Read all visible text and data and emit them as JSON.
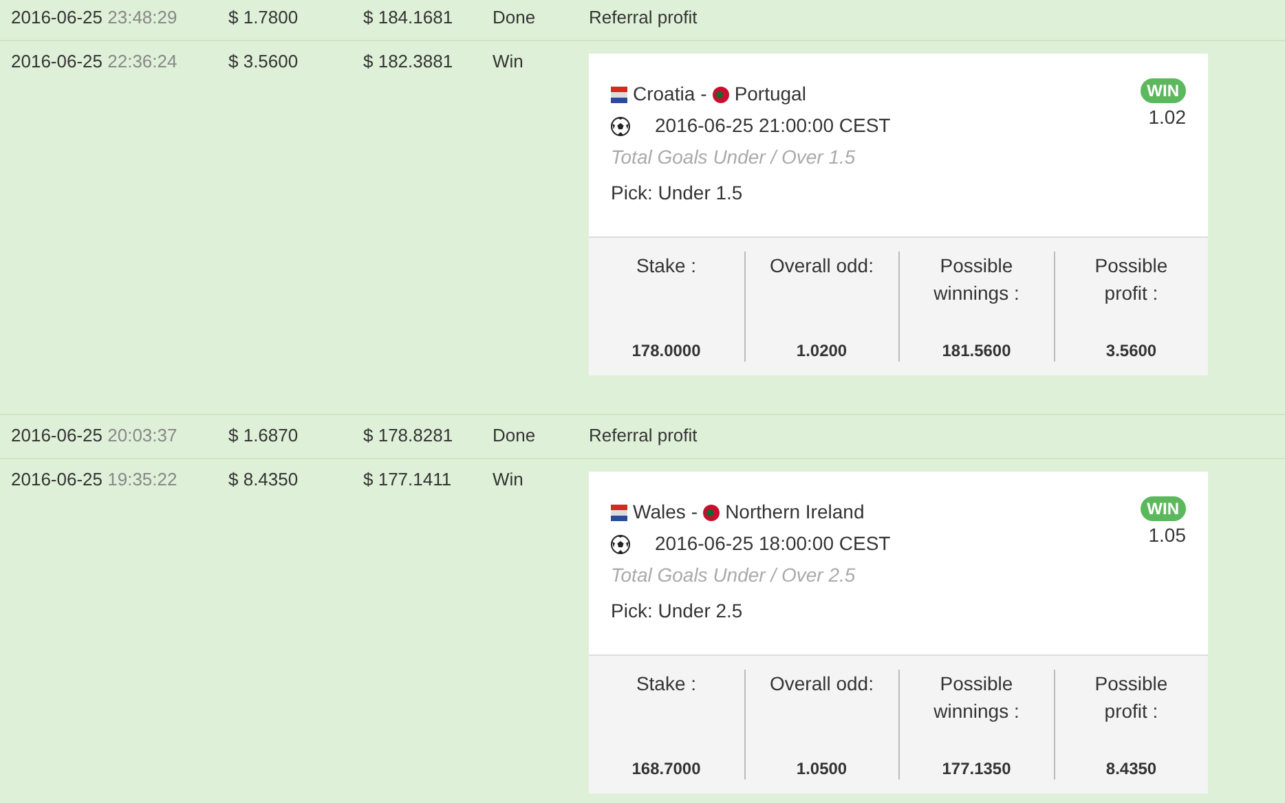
{
  "transactions": [
    {
      "kind": "plain",
      "date": "2016-06-25",
      "time": "23:48:29",
      "amount": "$ 1.7800",
      "balance": "$ 184.1681",
      "status": "Done",
      "details": "Referral profit"
    },
    {
      "kind": "bet",
      "date": "2016-06-25",
      "time": "22:36:24",
      "amount": "$ 3.5600",
      "balance": "$ 182.3881",
      "status": "Win",
      "bet": {
        "home": "Croatia",
        "separator": "-",
        "away": "Portugal",
        "start": "2016-06-25 21:00:00 CEST",
        "market": "Total Goals Under / Over 1.5",
        "pick": "Pick: Under 1.5",
        "result": "WIN",
        "odd": "1.02",
        "summary": [
          {
            "label": "Stake :",
            "value": "178.0000"
          },
          {
            "label": "Overall odd:",
            "value": "1.0200"
          },
          {
            "label": "Possible winnings :",
            "value": "181.5600"
          },
          {
            "label": "Possible profit :",
            "value": "3.5600"
          }
        ]
      }
    },
    {
      "kind": "plain",
      "date": "2016-06-25",
      "time": "20:03:37",
      "amount": "$ 1.6870",
      "balance": "$ 178.8281",
      "status": "Done",
      "details": "Referral profit"
    },
    {
      "kind": "bet",
      "date": "2016-06-25",
      "time": "19:35:22",
      "amount": "$ 8.4350",
      "balance": "$ 177.1411",
      "status": "Win",
      "bet": {
        "home": "Wales",
        "separator": "-",
        "away": "Northern Ireland",
        "start": "2016-06-25 18:00:00 CEST",
        "market": "Total Goals Under / Over 2.5",
        "pick": "Pick: Under 2.5",
        "result": "WIN",
        "odd": "1.05",
        "summary": [
          {
            "label": "Stake :",
            "value": "168.7000"
          },
          {
            "label": "Overall odd:",
            "value": "1.0500"
          },
          {
            "label": "Possible winnings :",
            "value": "177.1350"
          },
          {
            "label": "Possible profit :",
            "value": "8.4350"
          }
        ]
      }
    }
  ]
}
